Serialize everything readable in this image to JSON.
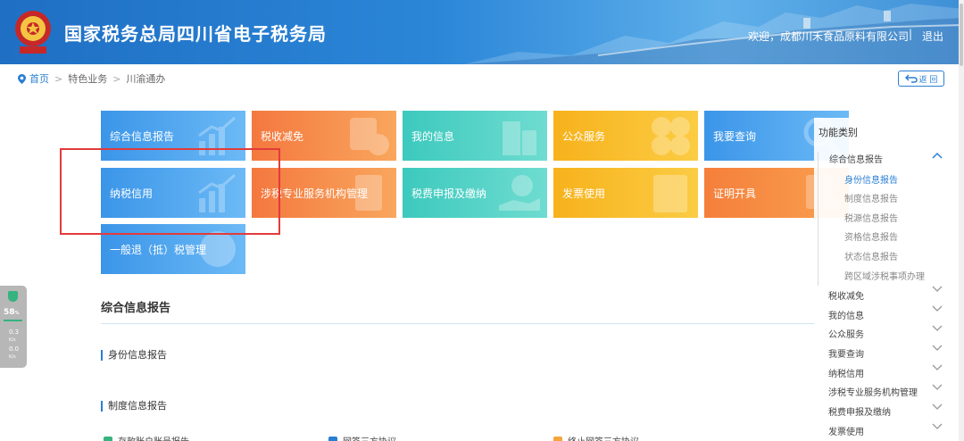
{
  "header": {
    "title": "国家税务总局四川省电子税务局",
    "welcome": "欢迎，成都川禾食品原料有限公司",
    "separator": "|",
    "logout_label": "退出"
  },
  "breadcrumb": {
    "home": "首页",
    "sep": ">",
    "level2": "特色业务",
    "level3": "川渝通办"
  },
  "back_label": "返 回",
  "tiles": [
    {
      "label": "综合信息报告"
    },
    {
      "label": "税收减免"
    },
    {
      "label": "我的信息"
    },
    {
      "label": "公众服务"
    },
    {
      "label": "我要查询"
    },
    {
      "label": "纳税信用"
    },
    {
      "label": "涉税专业服务机构管理"
    },
    {
      "label": "税费申报及缴纳"
    },
    {
      "label": "发票使用"
    },
    {
      "label": "证明开具"
    },
    {
      "label": "一般退（抵）税管理"
    }
  ],
  "content": {
    "section_title": "综合信息报告",
    "sub1": "身份信息报告",
    "sub2": "制度信息报告",
    "items": [
      "存款账户账号报告",
      "网签三方协议",
      "终止网签三方协议"
    ]
  },
  "side_menu": {
    "heading": "功能类别",
    "group1": "综合信息报告",
    "subs": [
      "身份信息报告",
      "制度信息报告",
      "税源信息报告",
      "资格信息报告",
      "状态信息报告",
      "跨区域涉税事项办理"
    ],
    "groups": [
      "税收减免",
      "我的信息",
      "公众服务",
      "我要查询",
      "纳税信用",
      "涉税专业服务机构管理",
      "税费申报及缴纳",
      "发票使用"
    ]
  },
  "widget": {
    "percent": "58",
    "percent_unit": "%",
    "up": "0.3",
    "down": "0.0",
    "unit": "K/s"
  },
  "colors": {
    "header_blue": "#2b86d8",
    "accent": "#2a7fd4",
    "highlight_red": "#e23b3b"
  }
}
